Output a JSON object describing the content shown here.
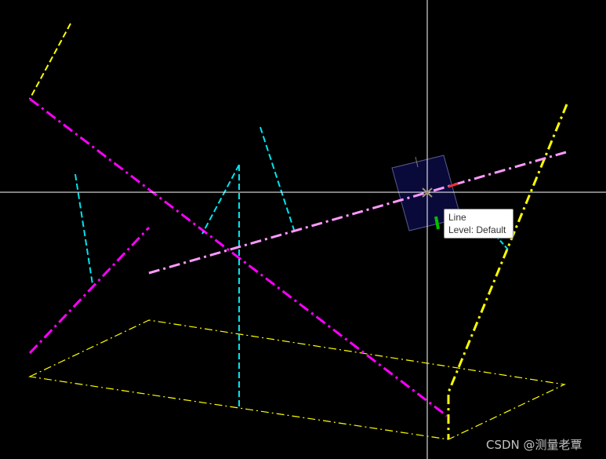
{
  "app": {
    "background_color": "#000000"
  },
  "colors": {
    "yellow": "#ffff00",
    "magenta": "#ff00ff",
    "cyan": "#00e5ee",
    "pink": "#ff99ff",
    "cursor": "#ffffff",
    "selection_box": "#0a0a3a"
  },
  "tooltip": {
    "element_type": "Line",
    "level": "Level: Default"
  },
  "watermark": {
    "text": "CSDN @测量老覃"
  },
  "cursor": {
    "icon": "crosshair-cursor-icon"
  }
}
